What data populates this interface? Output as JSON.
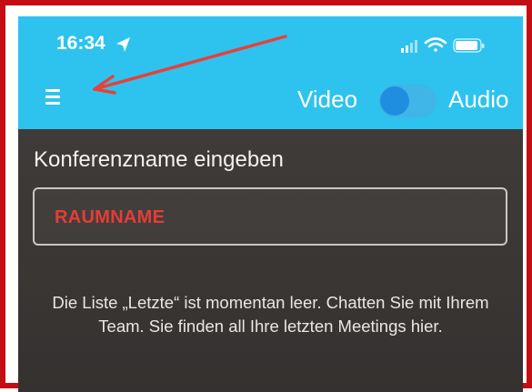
{
  "status_bar": {
    "time": "16:34",
    "location_icon": "location-arrow-icon",
    "signal_icon": "cellular-signal-icon",
    "wifi_icon": "wifi-icon",
    "battery_icon": "battery-icon"
  },
  "header": {
    "menu_icon": "hamburger-menu-icon",
    "mode_video_label": "Video",
    "mode_audio_label": "Audio",
    "mode_toggle_on": false
  },
  "annotation": {
    "arrow_icon": "red-arrow-annotation",
    "color": "#e8403a"
  },
  "conference": {
    "label": "Konferenzname eingeben",
    "input_value": "RAUMNAME",
    "input_value_color": "#e63c36"
  },
  "recent": {
    "empty_message": "Die Liste „Letzte“ ist momentan leer. Chatten Sie mit Ihrem Team. Sie finden all Ihre letzten Meetings hier."
  },
  "colors": {
    "header_bg": "#2dc3ee",
    "body_bg": "#3d3937",
    "frame_border": "#c40d14",
    "toggle_knob": "#1f8ee0"
  }
}
